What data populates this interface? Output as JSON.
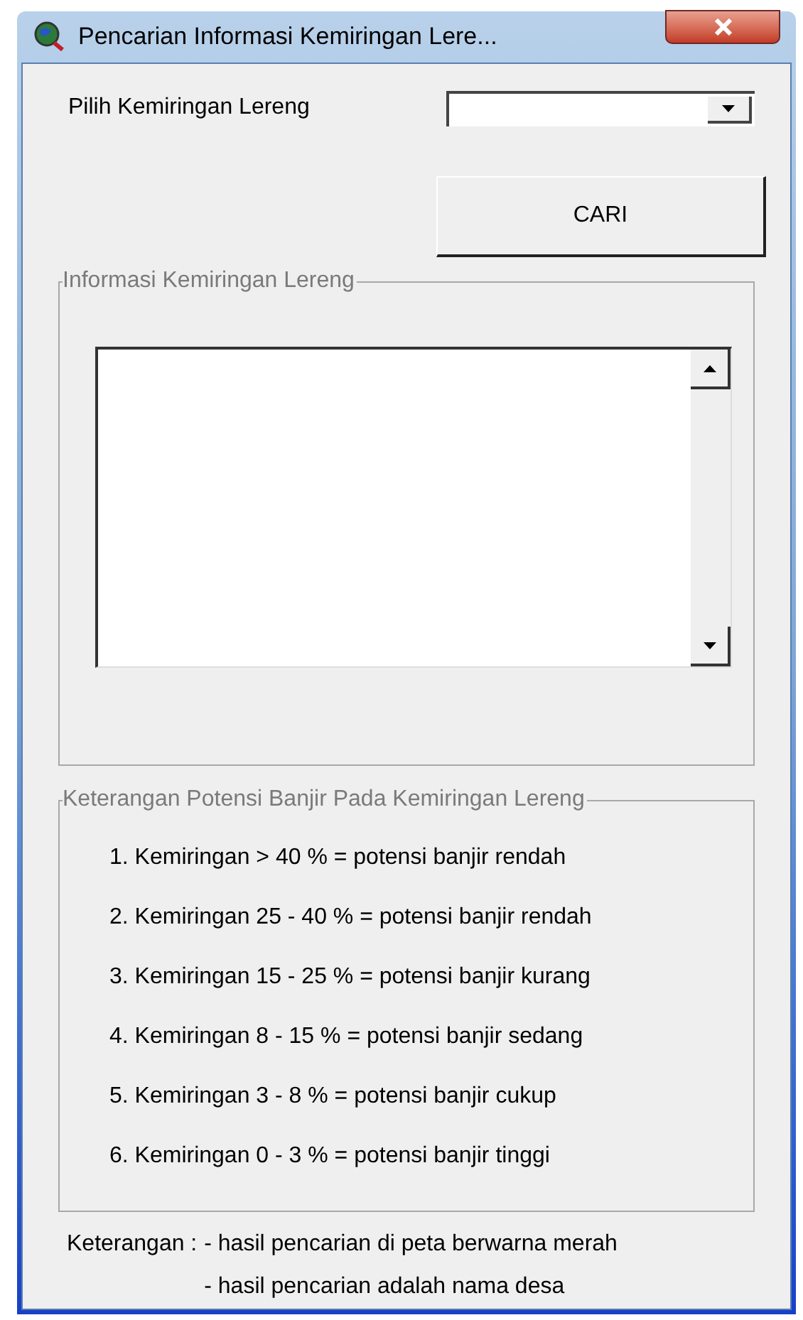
{
  "window": {
    "title": "Pencarian Informasi Kemiringan Lere..."
  },
  "slope_select": {
    "label": "Pilih Kemiringan Lereng"
  },
  "search_button": {
    "label": "CARI"
  },
  "info_group": {
    "title": "Informasi Kemiringan Lereng"
  },
  "legend_group": {
    "title": "Keterangan Potensi Banjir Pada Kemiringan Lereng",
    "items": [
      "1. Kemiringan > 40 % =  potensi banjir rendah",
      "2. Kemiringan 25 - 40 % =  potensi banjir rendah",
      "3. Kemiringan 15 - 25 % =  potensi banjir kurang",
      "4. Kemiringan 8 - 15 % =  potensi banjir sedang",
      "5. Kemiringan 3 - 8 % =  potensi banjir cukup",
      "6. Kemiringan 0 - 3 % =  potensi banjir tinggi"
    ]
  },
  "notes": {
    "label": "Keterangan :",
    "lines": [
      "- hasil pencarian di peta berwarna merah",
      "- hasil pencarian adalah nama desa"
    ]
  }
}
